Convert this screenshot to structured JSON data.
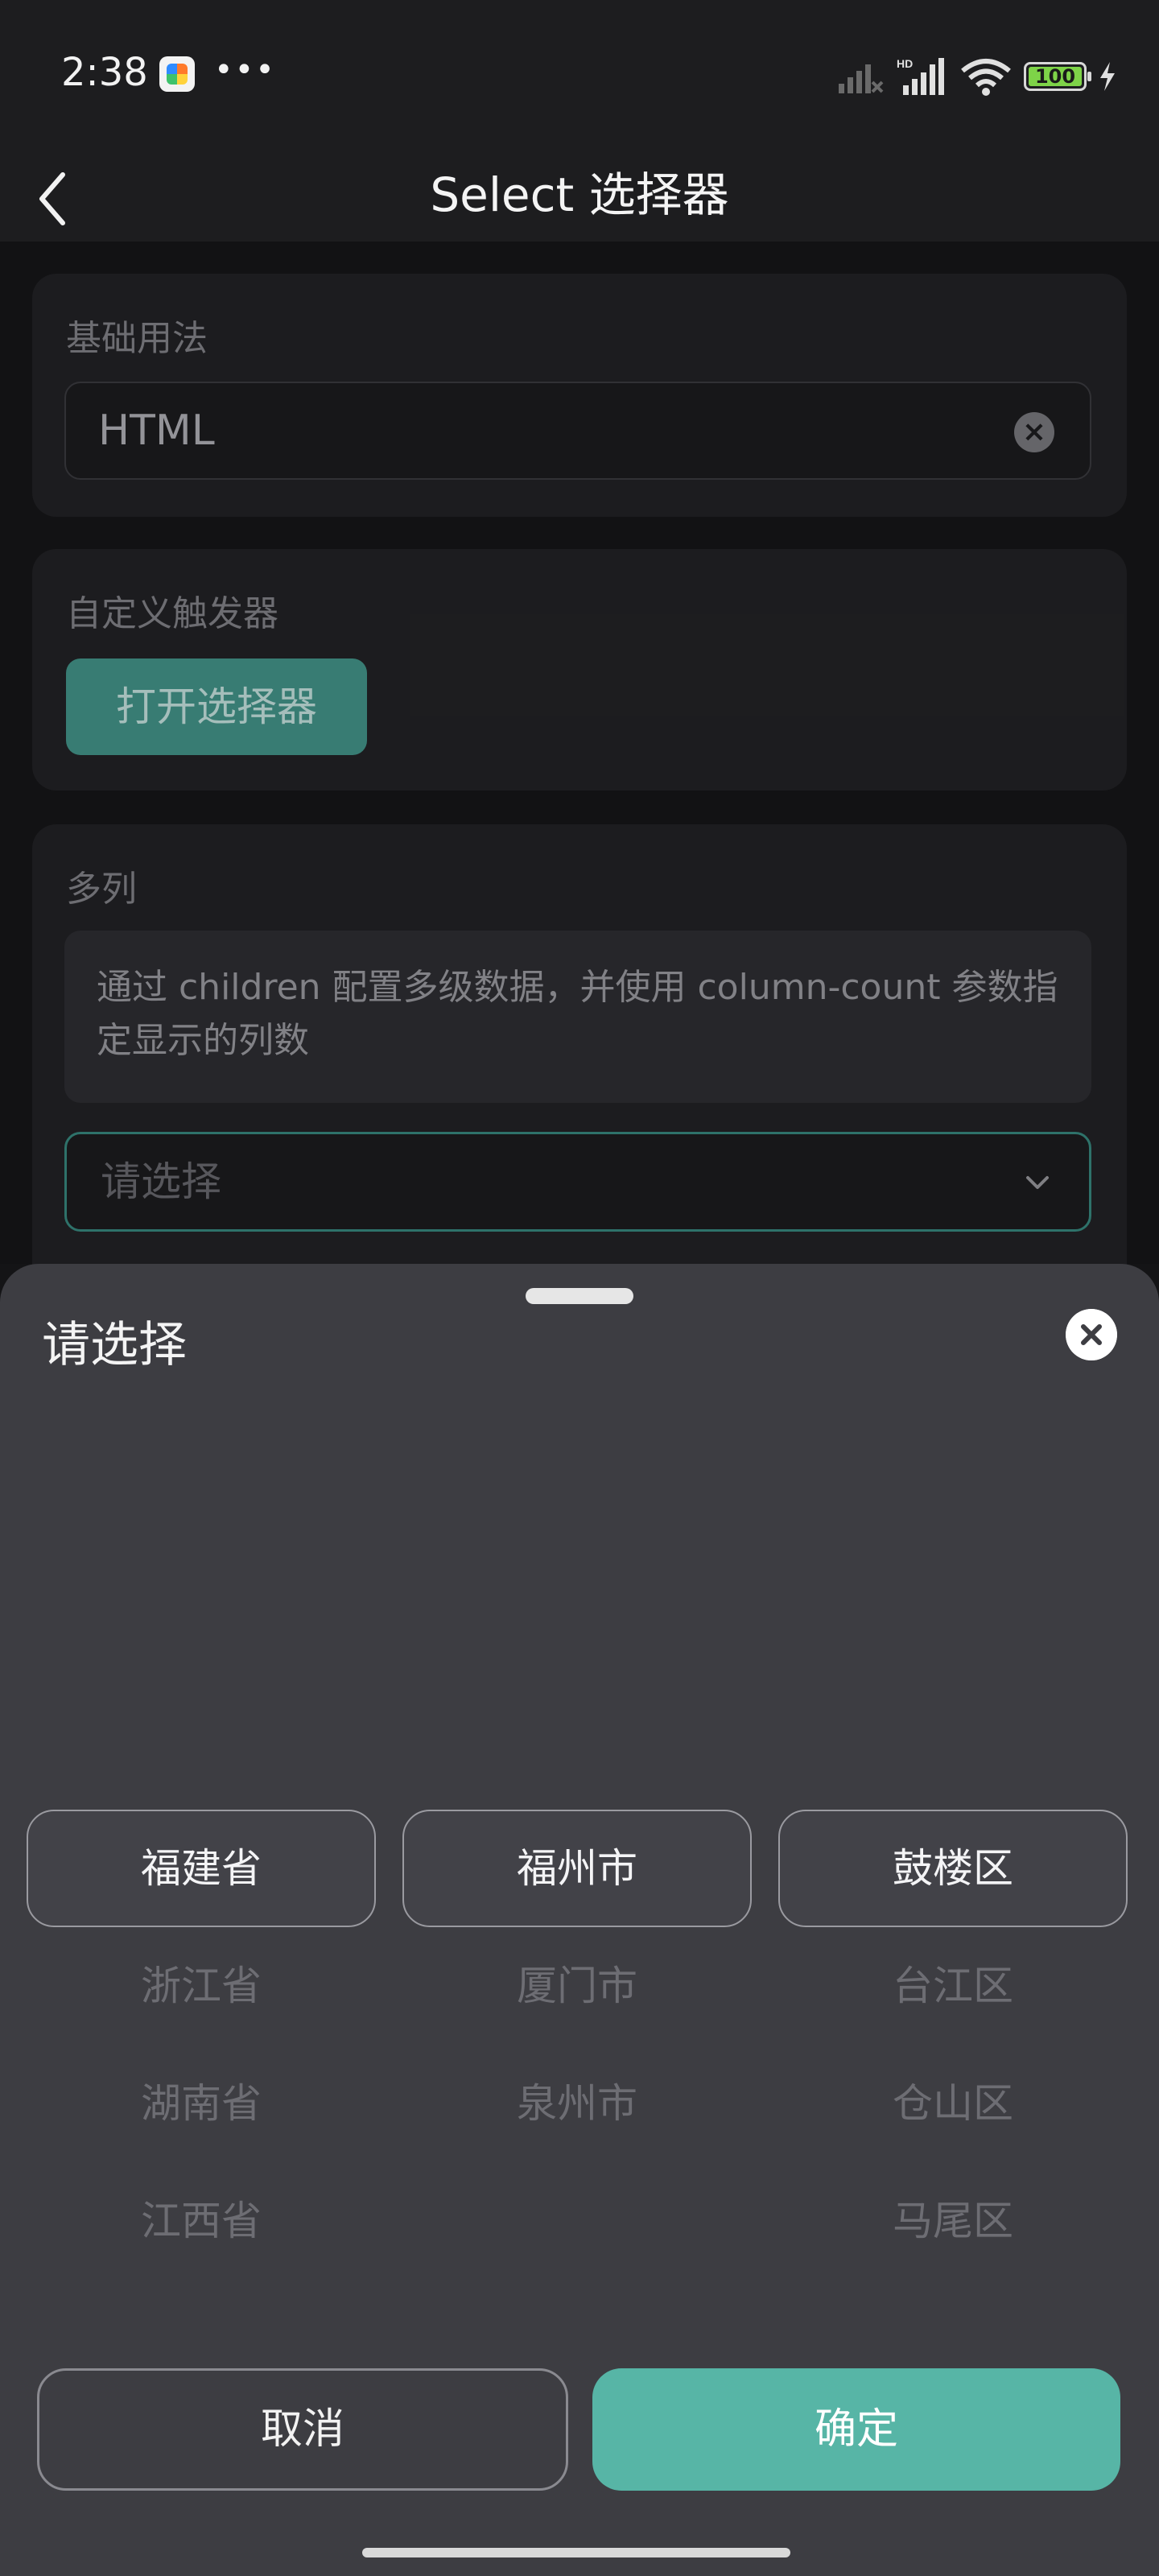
{
  "status_bar": {
    "time": "2:38",
    "battery": "100"
  },
  "nav": {
    "title": "Select 选择器"
  },
  "basic": {
    "label": "基础用法",
    "value": "HTML"
  },
  "custom_trigger": {
    "label": "自定义触发器",
    "button": "打开选择器"
  },
  "multi": {
    "label": "多列",
    "notice": "通过 children 配置多级数据，并使用 column-count 参数指定显示的列数",
    "placeholder": "请选择"
  },
  "sheet": {
    "title": "请选择",
    "columns": [
      {
        "selected": "福建省",
        "options": [
          "浙江省",
          "湖南省",
          "江西省"
        ]
      },
      {
        "selected": "福州市",
        "options": [
          "厦门市",
          "泉州市"
        ]
      },
      {
        "selected": "鼓楼区",
        "options": [
          "台江区",
          "仓山区",
          "马尾区"
        ]
      }
    ],
    "cancel": "取消",
    "confirm": "确定"
  },
  "colors": {
    "accent": "#57b5a6",
    "trigger": "#3d877d",
    "sheet_bg": "#3d3d42"
  },
  "icons": [
    "back-arrow-icon",
    "clear-icon",
    "chevron-down-icon",
    "close-icon",
    "signal-icon",
    "wifi-icon",
    "battery-icon",
    "charging-icon"
  ]
}
